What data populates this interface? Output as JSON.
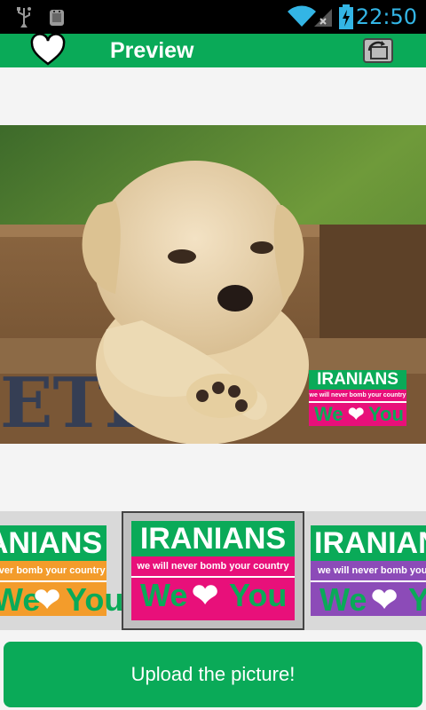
{
  "status_bar": {
    "time": "22:50",
    "icons": [
      "usb-icon",
      "android-debug-icon",
      "wifi-icon",
      "signal-icon",
      "battery-charging-icon"
    ]
  },
  "action_bar": {
    "title": "Preview",
    "left_icon": "heart-icon",
    "right_icon": "rotate-icon"
  },
  "overlay_logo": {
    "title": "IRANIANS",
    "subtitle": "we will never bomb your country",
    "love_text_left": "We",
    "love_text_right": "You"
  },
  "themes": [
    {
      "title": "IRANIANS",
      "subtitle": "we will never bomb your country",
      "left": "We",
      "right": "You",
      "color": "#f39c2b"
    },
    {
      "title": "IRANIANS",
      "subtitle": "we will never bomb your country",
      "left": "We",
      "right": "You",
      "color": "#e8107a"
    },
    {
      "title": "IRANIANS",
      "subtitle": "we will never bomb your country",
      "left": "We",
      "right": "You",
      "color": "#8c4bb8"
    }
  ],
  "upload_button": {
    "label": "Upload the picture!"
  },
  "colors": {
    "brand_green": "#0aaa58",
    "status_blue": "#33b5e5"
  }
}
